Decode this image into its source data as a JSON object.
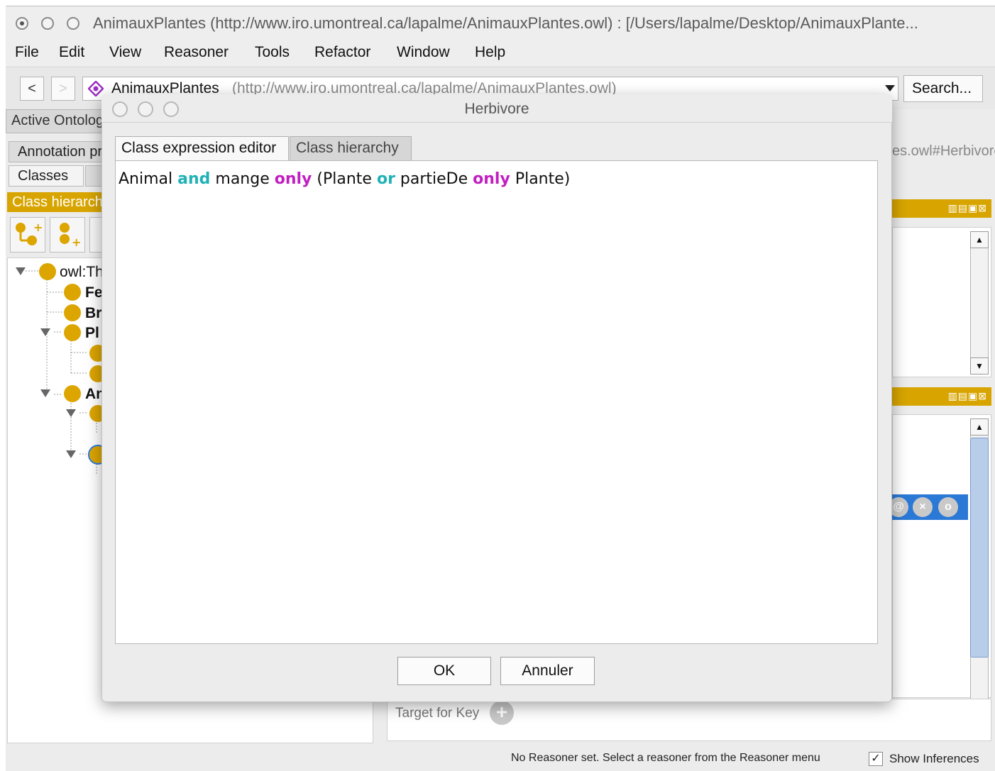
{
  "window": {
    "title": "AnimauxPlantes (http://www.iro.umontreal.ca/lapalme/AnimauxPlantes.owl)  : [/Users/lapalme/Desktop/AnimauxPlante..."
  },
  "menubar": {
    "items": [
      "File",
      "Edit",
      "View",
      "Reasoner",
      "Tools",
      "Refactor",
      "Window",
      "Help"
    ]
  },
  "toolbar": {
    "back_label": "<",
    "forward_label": ">",
    "ontology_name": "AnimauxPlantes",
    "ontology_iri": "(http://www.iro.umontreal.ca/lapalme/AnimauxPlantes.owl)",
    "search_label": "Search..."
  },
  "background": {
    "active_ontology_tab": "Active Ontology",
    "annotation_tab": "Annotation properties",
    "classes_tab": "Classes",
    "class_hierarchy_header": "Class hierarchy",
    "iri_suffix": "es.owl#Herbivore",
    "tree": {
      "root": "owl:Thing",
      "item_1": "Fe",
      "item_2": "Br",
      "item_3": "Pl",
      "item_4": "An"
    },
    "target_for_key": "Target for Key",
    "status": "No Reasoner set. Select a reasoner from the Reasoner menu",
    "show_inferences": "Show Inferences"
  },
  "dialog": {
    "title": "Herbivore",
    "tabs": [
      "Class expression editor",
      "Class hierarchy"
    ],
    "expression": {
      "t1": "Animal ",
      "k1": "and",
      "t2": " mange ",
      "k2": "only",
      "t3": " (Plante ",
      "k3": "or",
      "t4": " partieDe ",
      "k4": "only",
      "t5": " Plante)"
    },
    "ok_label": "OK",
    "cancel_label": "Annuler"
  },
  "colors": {
    "accent_orange": "#d8a500",
    "keyword_teal": "#20b2b6",
    "keyword_magenta": "#c21fc2",
    "selection_blue": "#2b79d6"
  }
}
